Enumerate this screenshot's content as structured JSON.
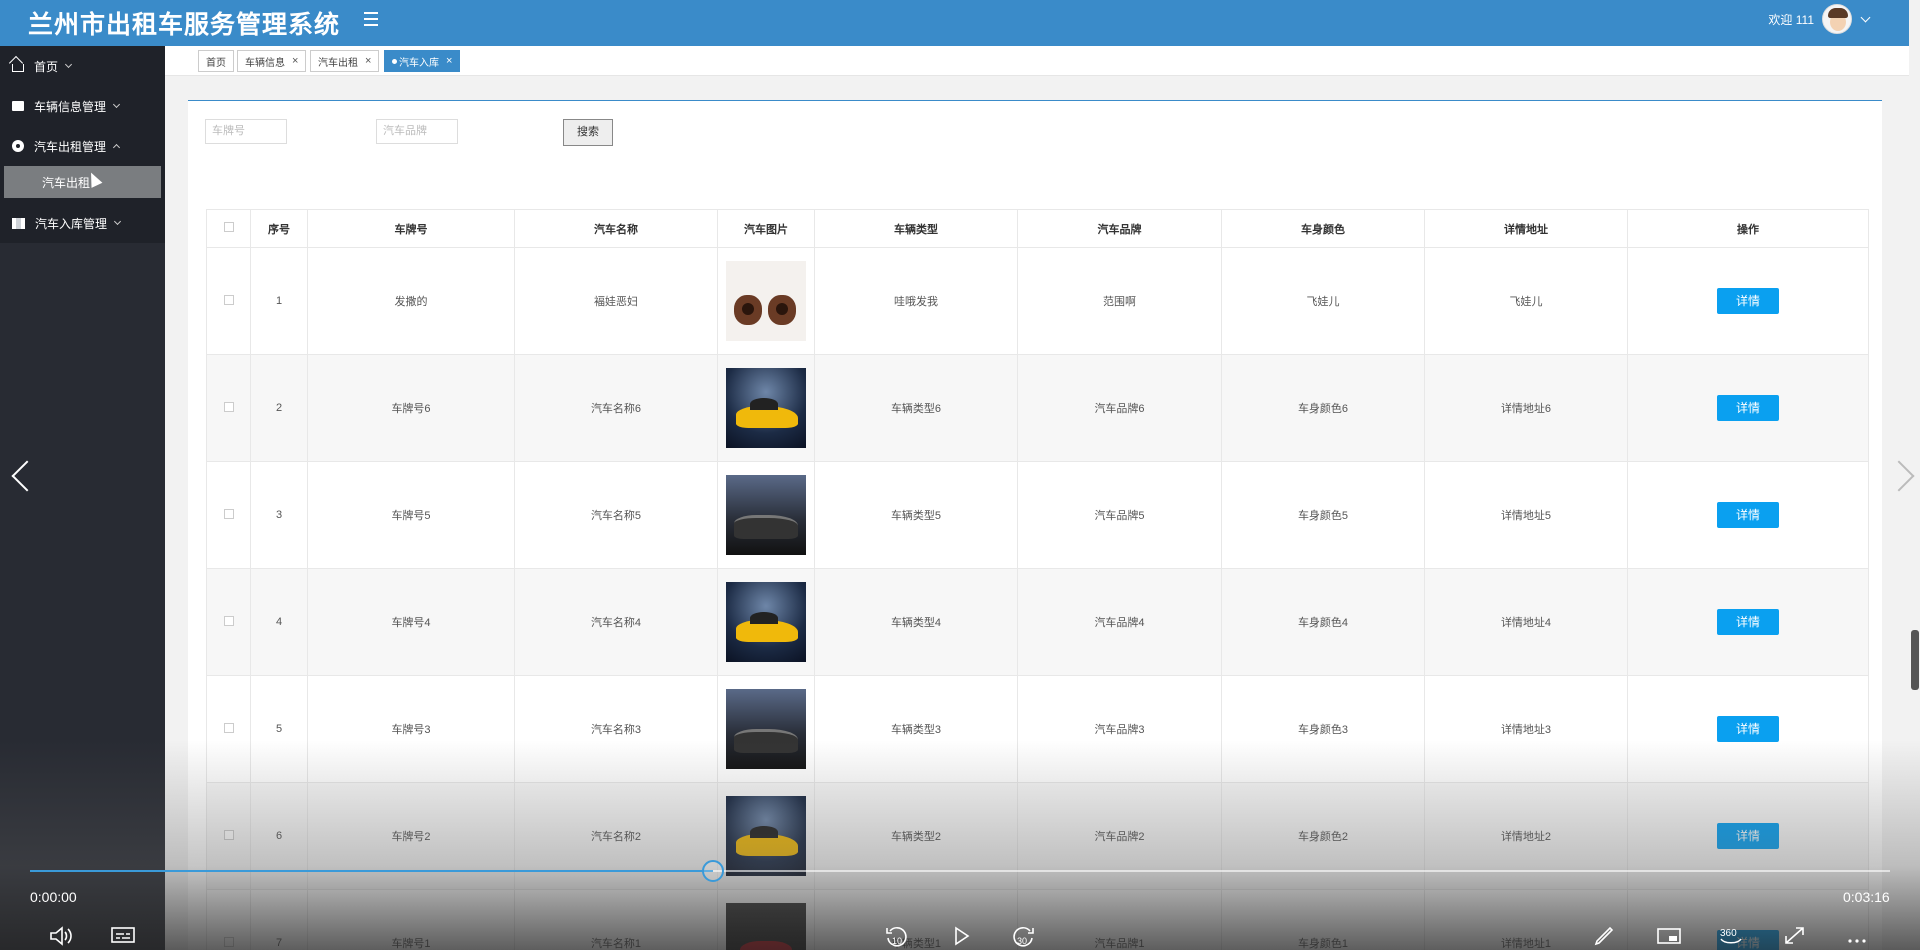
{
  "header": {
    "app_title": "兰州市出租车服务管理系统",
    "welcome": "欢迎 111"
  },
  "sidebar": {
    "items": [
      {
        "label": "首页",
        "icon": "home-icon"
      },
      {
        "label": "车辆信息管理",
        "icon": "card-icon"
      },
      {
        "label": "汽车出租管理",
        "icon": "circle-icon",
        "expanded": true
      },
      {
        "label": "汽车入库管理",
        "icon": "bars-icon"
      }
    ],
    "sub_item": "汽车出租"
  },
  "tabs": [
    {
      "label": "首页"
    },
    {
      "label": "车辆信息"
    },
    {
      "label": "汽车出租"
    },
    {
      "label": "汽车入库",
      "active": true
    }
  ],
  "search": {
    "plate_placeholder": "车牌号",
    "brand_placeholder": "汽车品牌",
    "button": "搜索"
  },
  "table": {
    "headers": [
      "序号",
      "车牌号",
      "汽车名称",
      "汽车图片",
      "车辆类型",
      "汽车品牌",
      "车身颜色",
      "详情地址",
      "操作"
    ],
    "action_label": "详情",
    "rows": [
      {
        "no": "1",
        "plate": "发撒的",
        "name": "褔娃恶妇",
        "image": "nuts",
        "type": "哇哦发我",
        "brand": "范围啊",
        "color": "飞娃儿",
        "address": "飞娃儿"
      },
      {
        "no": "2",
        "plate": "车牌号6",
        "name": "汽车名称6",
        "image": "yellow",
        "type": "车辆类型6",
        "brand": "汽车品牌6",
        "color": "车身颜色6",
        "address": "详情地址6"
      },
      {
        "no": "3",
        "plate": "车牌号5",
        "name": "汽车名称5",
        "image": "dark",
        "type": "车辆类型5",
        "brand": "汽车品牌5",
        "color": "车身颜色5",
        "address": "详情地址5"
      },
      {
        "no": "4",
        "plate": "车牌号4",
        "name": "汽车名称4",
        "image": "yellow",
        "type": "车辆类型4",
        "brand": "汽车品牌4",
        "color": "车身颜色4",
        "address": "详情地址4"
      },
      {
        "no": "5",
        "plate": "车牌号3",
        "name": "汽车名称3",
        "image": "dark",
        "type": "车辆类型3",
        "brand": "汽车品牌3",
        "color": "车身颜色3",
        "address": "详情地址3"
      },
      {
        "no": "6",
        "plate": "车牌号2",
        "name": "汽车名称2",
        "image": "yellow",
        "type": "车辆类型2",
        "brand": "汽车品牌2",
        "color": "车身颜色2",
        "address": "详情地址2"
      },
      {
        "no": "7",
        "plate": "车牌号1",
        "name": "汽车名称1",
        "image": "red",
        "type": "车辆类型1",
        "brand": "汽车品牌1",
        "color": "车身颜色1",
        "address": "详情地址1"
      }
    ]
  },
  "player": {
    "current_time": "0:00:00",
    "total_time": "0:03:16",
    "progress_fraction": 0.367,
    "skip_back": "10",
    "skip_forward": "30",
    "view_360": "360"
  },
  "colors": {
    "header_bg": "#3a8bc9",
    "sidebar_bg": "#282b33",
    "detail_button": "#0aa0f0",
    "progress": "#3a9ad9"
  }
}
